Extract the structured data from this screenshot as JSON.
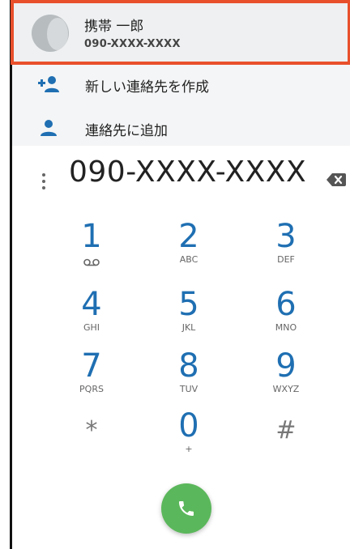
{
  "suggestion": {
    "name": "携帯 一郎",
    "number": "090-XXXX-XXXX"
  },
  "actions": [
    {
      "label": "新しい連絡先を作成",
      "icon": "add-person-icon"
    },
    {
      "label": "連絡先に追加",
      "icon": "person-icon"
    }
  ],
  "dialer": {
    "number": "090-XXXX-XXXX",
    "keys": [
      {
        "digit": "1",
        "letters": ""
      },
      {
        "digit": "2",
        "letters": "ABC"
      },
      {
        "digit": "3",
        "letters": "DEF"
      },
      {
        "digit": "4",
        "letters": "GHI"
      },
      {
        "digit": "5",
        "letters": "JKL"
      },
      {
        "digit": "6",
        "letters": "MNO"
      },
      {
        "digit": "7",
        "letters": "PQRS"
      },
      {
        "digit": "8",
        "letters": "TUV"
      },
      {
        "digit": "9",
        "letters": "WXYZ"
      },
      {
        "digit": "*",
        "letters": ""
      },
      {
        "digit": "0",
        "letters": "+"
      },
      {
        "digit": "#",
        "letters": ""
      }
    ]
  },
  "colors": {
    "accent": "#1f6fb2",
    "highlight_border": "#e8502c",
    "call": "#5bb75b"
  }
}
